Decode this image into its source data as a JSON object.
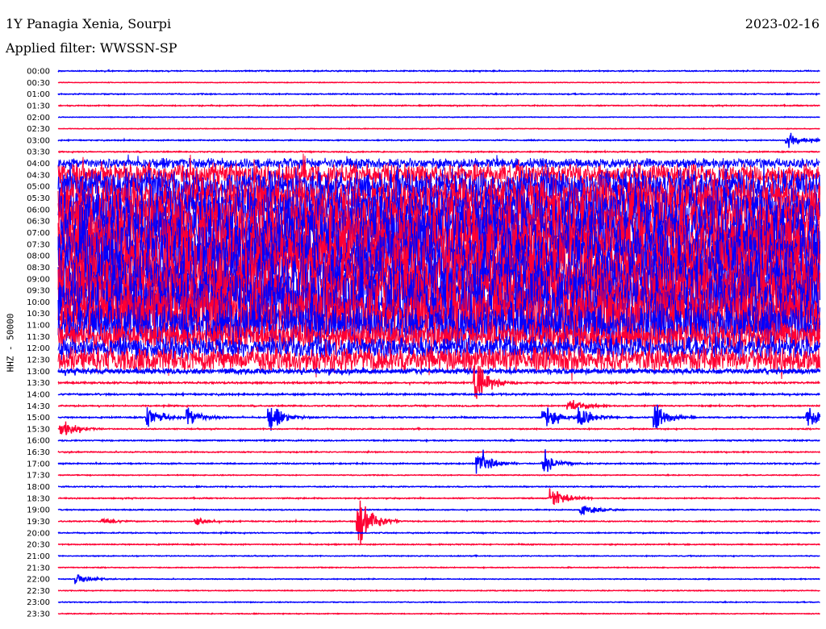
{
  "header": {
    "station": "1Y Panagia Xenia, Sourpi",
    "filter": "Applied filter: WWSSN-SP",
    "date": "2023-02-16"
  },
  "chart_data": {
    "type": "line",
    "title": "1Y Panagia Xenia, Sourpi",
    "ylabel": "HHZ - 50000",
    "colors": {
      "even": "#0000ff",
      "odd": "#ff0033"
    },
    "x_unit": "minutes within 30-min row",
    "xlim": [
      0,
      30
    ],
    "traces": [
      {
        "label": "00:00",
        "amp": 0.05
      },
      {
        "label": "00:30",
        "amp": 0.03
      },
      {
        "label": "01:00",
        "amp": 0.05
      },
      {
        "label": "01:30",
        "amp": 0.05
      },
      {
        "label": "02:00",
        "amp": 0.03
      },
      {
        "label": "02:30",
        "amp": 0.03
      },
      {
        "label": "03:00",
        "amp": 0.05
      },
      {
        "label": "03:30",
        "amp": 0.05
      },
      {
        "label": "04:00",
        "amp": 0.5
      },
      {
        "label": "04:30",
        "amp": 1.1
      },
      {
        "label": "05:00",
        "amp": 1.6
      },
      {
        "label": "05:30",
        "amp": 2.0
      },
      {
        "label": "06:00",
        "amp": 2.4
      },
      {
        "label": "06:30",
        "amp": 2.8
      },
      {
        "label": "07:00",
        "amp": 3.0
      },
      {
        "label": "07:30",
        "amp": 3.0
      },
      {
        "label": "08:00",
        "amp": 3.0
      },
      {
        "label": "08:30",
        "amp": 3.0
      },
      {
        "label": "09:00",
        "amp": 3.0
      },
      {
        "label": "09:30",
        "amp": 3.0
      },
      {
        "label": "10:00",
        "amp": 3.0
      },
      {
        "label": "10:30",
        "amp": 2.8
      },
      {
        "label": "11:00",
        "amp": 2.2
      },
      {
        "label": "11:30",
        "amp": 1.4
      },
      {
        "label": "12:00",
        "amp": 1.1
      },
      {
        "label": "12:30",
        "amp": 1.2
      },
      {
        "label": "13:00",
        "amp": 0.25
      },
      {
        "label": "13:30",
        "amp": 0.08
      },
      {
        "label": "14:00",
        "amp": 0.08
      },
      {
        "label": "14:30",
        "amp": 0.06
      },
      {
        "label": "15:00",
        "amp": 0.06
      },
      {
        "label": "15:30",
        "amp": 0.05
      },
      {
        "label": "16:00",
        "amp": 0.06
      },
      {
        "label": "16:30",
        "amp": 0.05
      },
      {
        "label": "17:00",
        "amp": 0.06
      },
      {
        "label": "17:30",
        "amp": 0.04
      },
      {
        "label": "18:00",
        "amp": 0.05
      },
      {
        "label": "18:30",
        "amp": 0.05
      },
      {
        "label": "19:00",
        "amp": 0.05
      },
      {
        "label": "19:30",
        "amp": 0.05
      },
      {
        "label": "20:00",
        "amp": 0.05
      },
      {
        "label": "20:30",
        "amp": 0.05
      },
      {
        "label": "21:00",
        "amp": 0.04
      },
      {
        "label": "21:30",
        "amp": 0.04
      },
      {
        "label": "22:00",
        "amp": 0.04
      },
      {
        "label": "22:30",
        "amp": 0.04
      },
      {
        "label": "23:00",
        "amp": 0.04
      },
      {
        "label": "23:30",
        "amp": 0.04
      }
    ],
    "events": [
      {
        "trace": 6,
        "minute": 28.8,
        "amp": 0.7
      },
      {
        "trace": 27,
        "minute": 16.5,
        "amp": 2.0
      },
      {
        "trace": 29,
        "minute": 20.2,
        "amp": 0.6
      },
      {
        "trace": 30,
        "minute": 3.6,
        "amp": 1.1
      },
      {
        "trace": 30,
        "minute": 5.2,
        "amp": 0.9
      },
      {
        "trace": 30,
        "minute": 8.4,
        "amp": 1.2
      },
      {
        "trace": 30,
        "minute": 19.2,
        "amp": 1.1
      },
      {
        "trace": 30,
        "minute": 20.6,
        "amp": 1.0
      },
      {
        "trace": 30,
        "minute": 23.6,
        "amp": 1.2
      },
      {
        "trace": 30,
        "minute": 29.6,
        "amp": 0.9
      },
      {
        "trace": 31,
        "minute": 0.2,
        "amp": 0.9
      },
      {
        "trace": 34,
        "minute": 16.6,
        "amp": 1.2
      },
      {
        "trace": 34,
        "minute": 19.2,
        "amp": 0.9
      },
      {
        "trace": 37,
        "minute": 19.5,
        "amp": 1.0
      },
      {
        "trace": 38,
        "minute": 20.7,
        "amp": 0.6
      },
      {
        "trace": 39,
        "minute": 11.9,
        "amp": 2.3
      },
      {
        "trace": 39,
        "minute": 5.5,
        "amp": 0.3
      },
      {
        "trace": 39,
        "minute": 1.8,
        "amp": 0.3
      },
      {
        "trace": 44,
        "minute": 0.8,
        "amp": 0.45
      }
    ]
  }
}
